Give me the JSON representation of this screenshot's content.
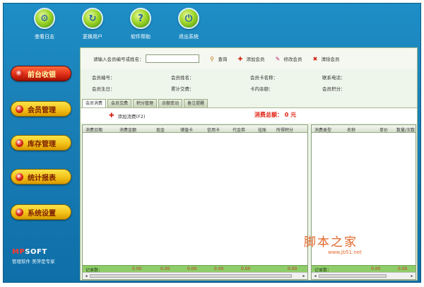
{
  "toolbar": [
    {
      "label": "查看日志",
      "icon": "log-icon",
      "glyph": "⚙"
    },
    {
      "label": "更换用户",
      "icon": "switch-user-icon",
      "glyph": "↻"
    },
    {
      "label": "软件帮助",
      "icon": "help-icon",
      "glyph": "?"
    },
    {
      "label": "退出系统",
      "icon": "power-icon",
      "glyph": "⏻"
    }
  ],
  "nav": [
    {
      "label": "前台收银",
      "active": true
    },
    {
      "label": "会员管理",
      "active": false
    },
    {
      "label": "库存管理",
      "active": false
    },
    {
      "label": "统计报表",
      "active": false
    },
    {
      "label": "系统设置",
      "active": false
    }
  ],
  "brand": {
    "logo_prefix": "MP",
    "logo_suffix": "SOFT",
    "slogan": "管理软件  美萍是专家"
  },
  "search": {
    "label": "请输入会员编号或姓名：",
    "value": "",
    "query": "查询",
    "add_member": "添加会员",
    "edit_member": "修改会员",
    "clear_member": "清除会员"
  },
  "info": {
    "member_no": "会员编号：",
    "member_name": "会员姓名：",
    "card_name": "会员卡名称：",
    "phone": "联系电话：",
    "birthday": "会员生日：",
    "total_consume": "累计交费：",
    "card_balance": "卡内余额：",
    "points": "会员积分："
  },
  "tabs": [
    "会员消费",
    "会员交费",
    "积分管理",
    "余额变动",
    "备注提醒"
  ],
  "consume": {
    "add_label": "添加消费(F2)",
    "total_label": "消费总额：",
    "total_value": "0",
    "total_unit": "元"
  },
  "grid1": {
    "columns": [
      "消费日期",
      "消费金额",
      "现金",
      "储值卡",
      "信用卡",
      "代金券",
      "挂账",
      "所得积分"
    ],
    "footer_label": "记录数：",
    "footer_values": [
      "0.00",
      "0.00",
      "0.00",
      "0.00",
      "0.00",
      "0.00"
    ]
  },
  "grid2": {
    "columns": [
      "消费类型",
      "名称",
      "单价",
      "数量/次数"
    ],
    "footer_label": "记录数：",
    "footer_values": [
      "0.00",
      "0.00"
    ]
  },
  "watermark": {
    "title": "脚本之家",
    "url": "www.jb51.net"
  }
}
